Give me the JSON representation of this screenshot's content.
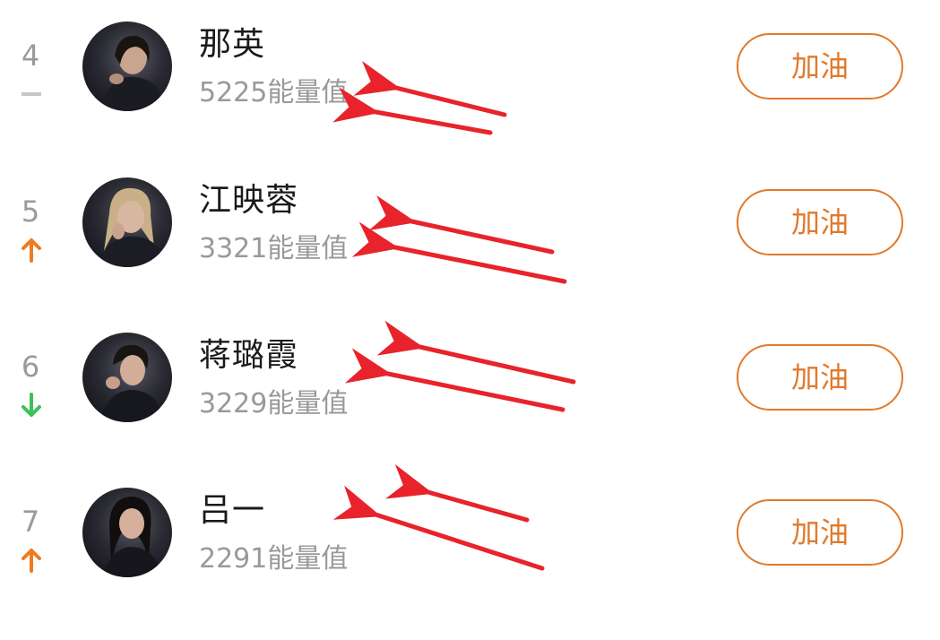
{
  "ranking": {
    "energy_unit": "能量值",
    "cheer_label": "加油",
    "items": [
      {
        "rank": "4",
        "trend": "same",
        "name": "那英",
        "energy": "5225能量值"
      },
      {
        "rank": "5",
        "trend": "up",
        "name": "江映蓉",
        "energy": "3321能量值"
      },
      {
        "rank": "6",
        "trend": "down",
        "name": "蒋璐霞",
        "energy": "3229能量值"
      },
      {
        "rank": "7",
        "trend": "up",
        "name": "吕一",
        "energy": "2291能量值"
      }
    ]
  },
  "colors": {
    "accent": "#e07a2c",
    "trend_up": "#f07a1e",
    "trend_down": "#3cc05a",
    "trend_same": "#c8c8c8",
    "annotation_arrow": "#e8232b"
  }
}
